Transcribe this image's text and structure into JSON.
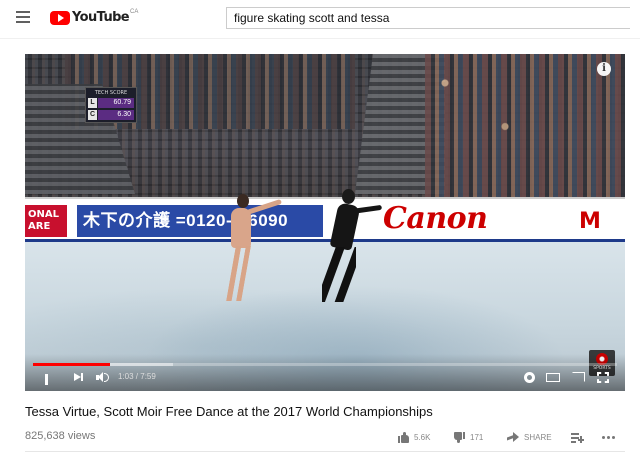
{
  "header": {
    "logo_text": "YouTube",
    "region": "CA",
    "search_value": "figure skating scott and tessa"
  },
  "player": {
    "tech_score": {
      "title": "TECH SCORE",
      "rows": [
        {
          "key": "L",
          "value": "60.79"
        },
        {
          "key": "C",
          "value": "6.30"
        }
      ]
    },
    "ads": {
      "national": "ONAL\nARE",
      "care": "木下の介護 =0120-8-6090",
      "canon": "Canon",
      "m": "M"
    },
    "sports_label": "SPORTS",
    "time_display": "1:03 / 7:59",
    "progress_played_fraction": 0.132,
    "progress_loaded_fraction": 0.24,
    "info_icon_glyph": "i"
  },
  "video": {
    "title": "Tessa Virtue, Scott Moir Free Dance at the 2017 World Championships",
    "views": "825,638 views",
    "likes": "5.6K",
    "dislikes": "171",
    "share_label": "SHARE"
  },
  "icons": [
    "menu-icon",
    "youtube-logo-icon",
    "info-icon",
    "pause-icon",
    "next-icon",
    "volume-icon",
    "settings-gear-icon",
    "theater-mode-icon",
    "cast-icon",
    "fullscreen-icon",
    "thumbs-up-icon",
    "thumbs-down-icon",
    "share-icon",
    "add-to-playlist-icon",
    "more-icon",
    "cbc-sports-icon"
  ]
}
